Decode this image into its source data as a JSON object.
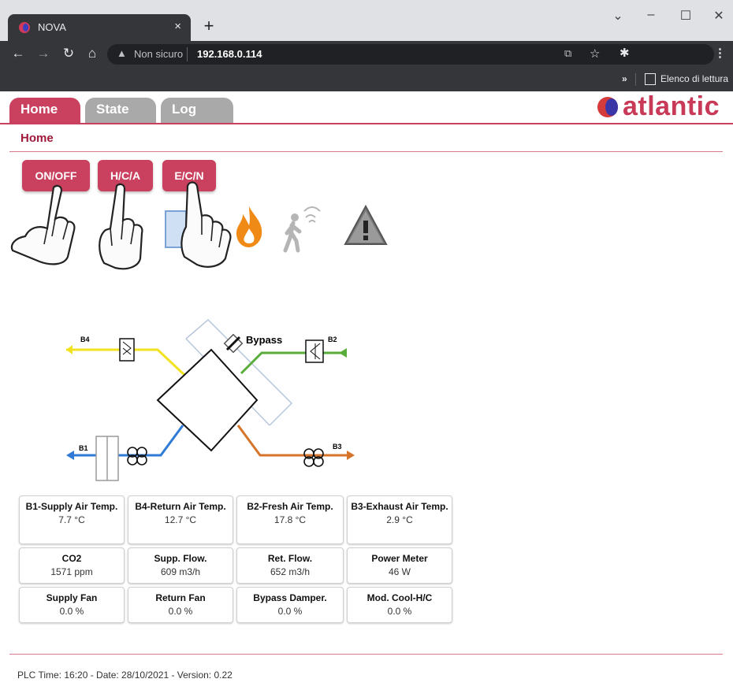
{
  "browser": {
    "tab_title": "NOVA",
    "tab_close": "×",
    "new_tab": "+",
    "security_label": "Non sicuro",
    "url": "192.168.0.114",
    "bookmarks_more": "»",
    "reading_list": "Elenco di lettura",
    "window_controls": {
      "minimize": "–",
      "maximize": "☐",
      "close": "✕",
      "chevron": "⌄"
    }
  },
  "nav": {
    "tabs": [
      {
        "label": "Home",
        "active": true
      },
      {
        "label": "State",
        "active": false
      },
      {
        "label": "Log",
        "active": false
      }
    ],
    "brand": "atlantic"
  },
  "page": {
    "title": "Home"
  },
  "controls": {
    "buttons": [
      "ON/OFF",
      "H/C/A",
      "E/C/N"
    ],
    "status_icons": [
      "sun-icon",
      "flame-icon",
      "presence-icon",
      "warning-icon"
    ]
  },
  "diagram": {
    "labels": {
      "b4": "B4",
      "b2": "B2",
      "b1": "B1",
      "b3": "B3",
      "bypass": "Bypass"
    },
    "colors": {
      "return_air": "#f2e21f",
      "fresh_air": "#59ad3a",
      "supply_air": "#2f7ad6",
      "exhaust_air": "#d5742a"
    }
  },
  "readings": [
    {
      "label": "B1-Supply Air Temp.",
      "value": "7.7 °C"
    },
    {
      "label": "B4-Return Air Temp.",
      "value": "12.7 °C"
    },
    {
      "label": "B2-Fresh Air Temp.",
      "value": "17.8 °C"
    },
    {
      "label": "B3-Exhaust Air Temp.",
      "value": "2.9 °C"
    },
    {
      "label": "CO2",
      "value": "1571 ppm"
    },
    {
      "label": "Supp. Flow.",
      "value": "609 m3/h"
    },
    {
      "label": "Ret. Flow.",
      "value": "652 m3/h"
    },
    {
      "label": "Power Meter",
      "value": "46 W"
    },
    {
      "label": "Supply Fan",
      "value": "0.0 %"
    },
    {
      "label": "Return Fan",
      "value": "0.0 %"
    },
    {
      "label": "Bypass Damper.",
      "value": "0.0 %"
    },
    {
      "label": "Mod. Cool-H/C",
      "value": "0.0 %"
    }
  ],
  "footer": "PLC Time: 16:20 - Date: 28/10/2021 - Version: 0.22",
  "theme": {
    "accent": "#c9415f",
    "inactive_tab": "#a9a9a9"
  }
}
